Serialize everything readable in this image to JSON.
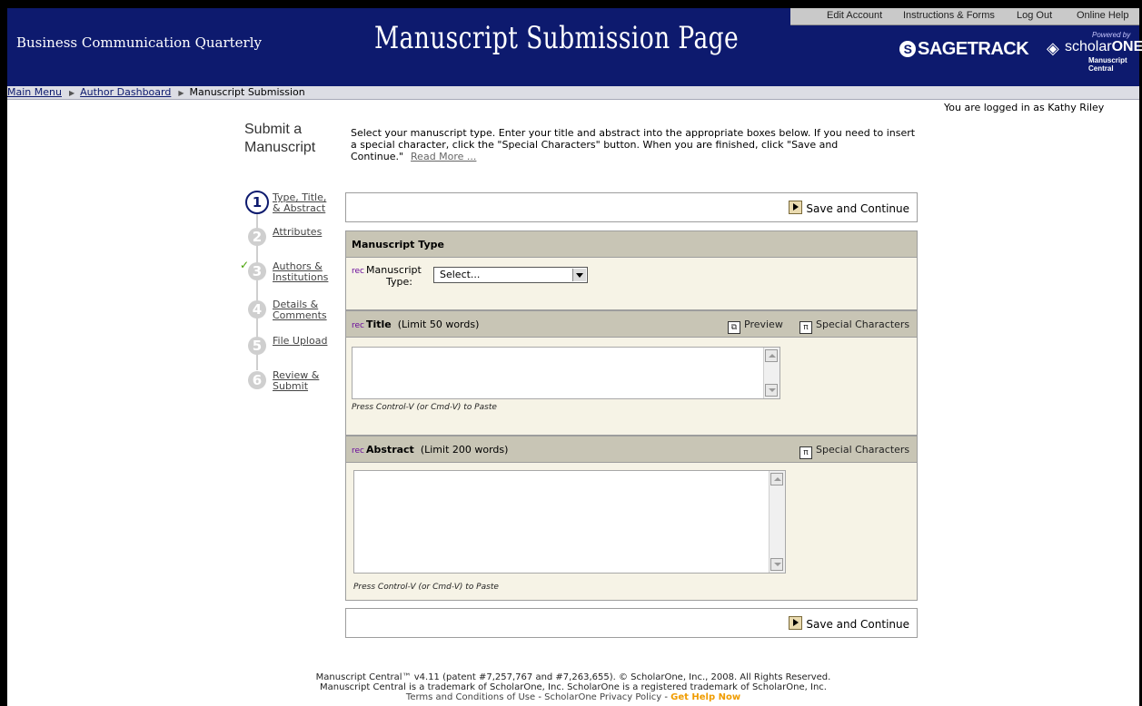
{
  "header": {
    "journal": "Business Communication Quarterly",
    "title": "Manuscript Submission Page",
    "links": [
      "Edit Account",
      "Instructions & Forms",
      "Log Out",
      "Online Help"
    ],
    "logo_sage": "SAGETRACK",
    "logo_powered": "Powered by",
    "logo_scholar_a": "scholar",
    "logo_scholar_b": "ONE",
    "logo_mc": "Manuscript Central"
  },
  "breadcrumb": [
    "Main Menu",
    "Author Dashboard",
    "Manuscript Submission"
  ],
  "logged_in": "You are logged in as Kathy Riley",
  "submit_title_1": "Submit a",
  "submit_title_2": "Manuscript",
  "instructions": "Select your manuscript type. Enter your title and abstract into the appropriate boxes below. If you need to insert a special character, click the \"Special Characters\" button. When you are finished, click \"Save and Continue.\"",
  "read_more": "Read More ...",
  "steps": [
    {
      "num": "1",
      "l1": "Type, Title,",
      "l2": "& Abstract"
    },
    {
      "num": "2",
      "l1": "Attributes",
      "l2": ""
    },
    {
      "num": "3",
      "l1": "Authors &",
      "l2": "Institutions"
    },
    {
      "num": "4",
      "l1": "Details &",
      "l2": "Comments"
    },
    {
      "num": "5",
      "l1": "File Upload",
      "l2": ""
    },
    {
      "num": "6",
      "l1": "Review &",
      "l2": "Submit"
    }
  ],
  "step_check": "✓",
  "save_label": "Save and Continue",
  "req": "rec",
  "manuscript_type": {
    "heading": "Manuscript Type",
    "label_1": "Manuscript",
    "label_2": "Type:",
    "selected": "Select..."
  },
  "title_section": {
    "heading": "Title",
    "limit": "(Limit 50 words)",
    "preview": "Preview",
    "special": "Special Characters",
    "paste": "Press Control-V (or Cmd-V) to Paste"
  },
  "abstract_section": {
    "heading": "Abstract",
    "limit": "(Limit 200 words)",
    "special": "Special Characters",
    "paste": "Press Control-V (or Cmd-V) to Paste"
  },
  "footer": {
    "line1": "Manuscript Central™ v4.11 (patent #7,257,767 and #7,263,655). © ScholarOne, Inc., 2008. All Rights Reserved.",
    "line2": "Manuscript Central is a trademark of ScholarOne, Inc. ScholarOne is a registered trademark of ScholarOne, Inc.",
    "terms": "Terms and Conditions of Use",
    "privacy": "ScholarOne Privacy Policy",
    "help": "Get Help Now"
  }
}
